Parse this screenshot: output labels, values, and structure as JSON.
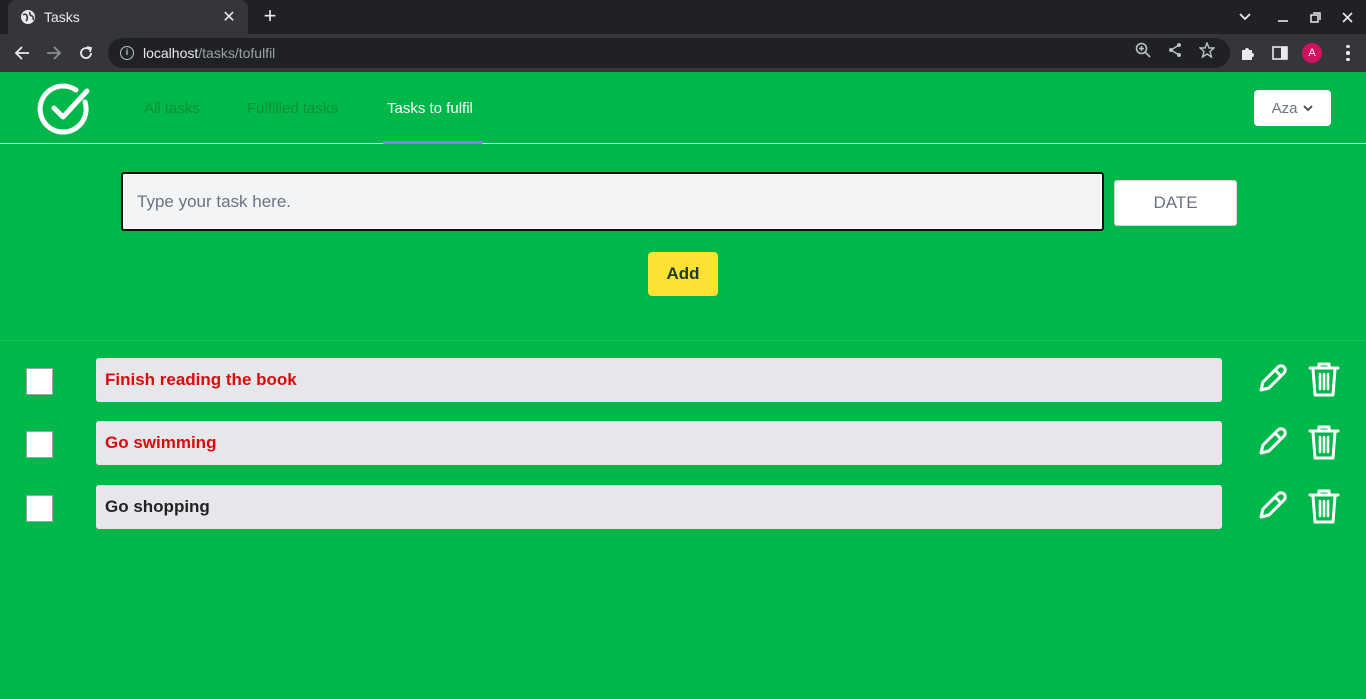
{
  "browser": {
    "tab_title": "Tasks",
    "url_host": "localhost",
    "url_path": "/tasks/tofulfil",
    "avatar_letter": "A"
  },
  "app": {
    "nav": [
      {
        "label": "All tasks",
        "active": false
      },
      {
        "label": "Fulfilled tasks",
        "active": false
      },
      {
        "label": "Tasks to fulfil",
        "active": true
      }
    ],
    "user_label": "Aza",
    "input_placeholder": "Type your task here.",
    "date_label": "DATE",
    "add_label": "Add",
    "tasks": [
      {
        "title": "Finish reading the book",
        "status": "overdue",
        "done": false
      },
      {
        "title": "Go swimming",
        "status": "overdue",
        "done": false
      },
      {
        "title": "Go shopping",
        "status": "normal",
        "done": false
      }
    ]
  },
  "colors": {
    "background": "#00b84a",
    "accent_yellow": "#fde234",
    "overdue_red": "#dc0b0b",
    "nav_underline": "#8b7cf6"
  }
}
